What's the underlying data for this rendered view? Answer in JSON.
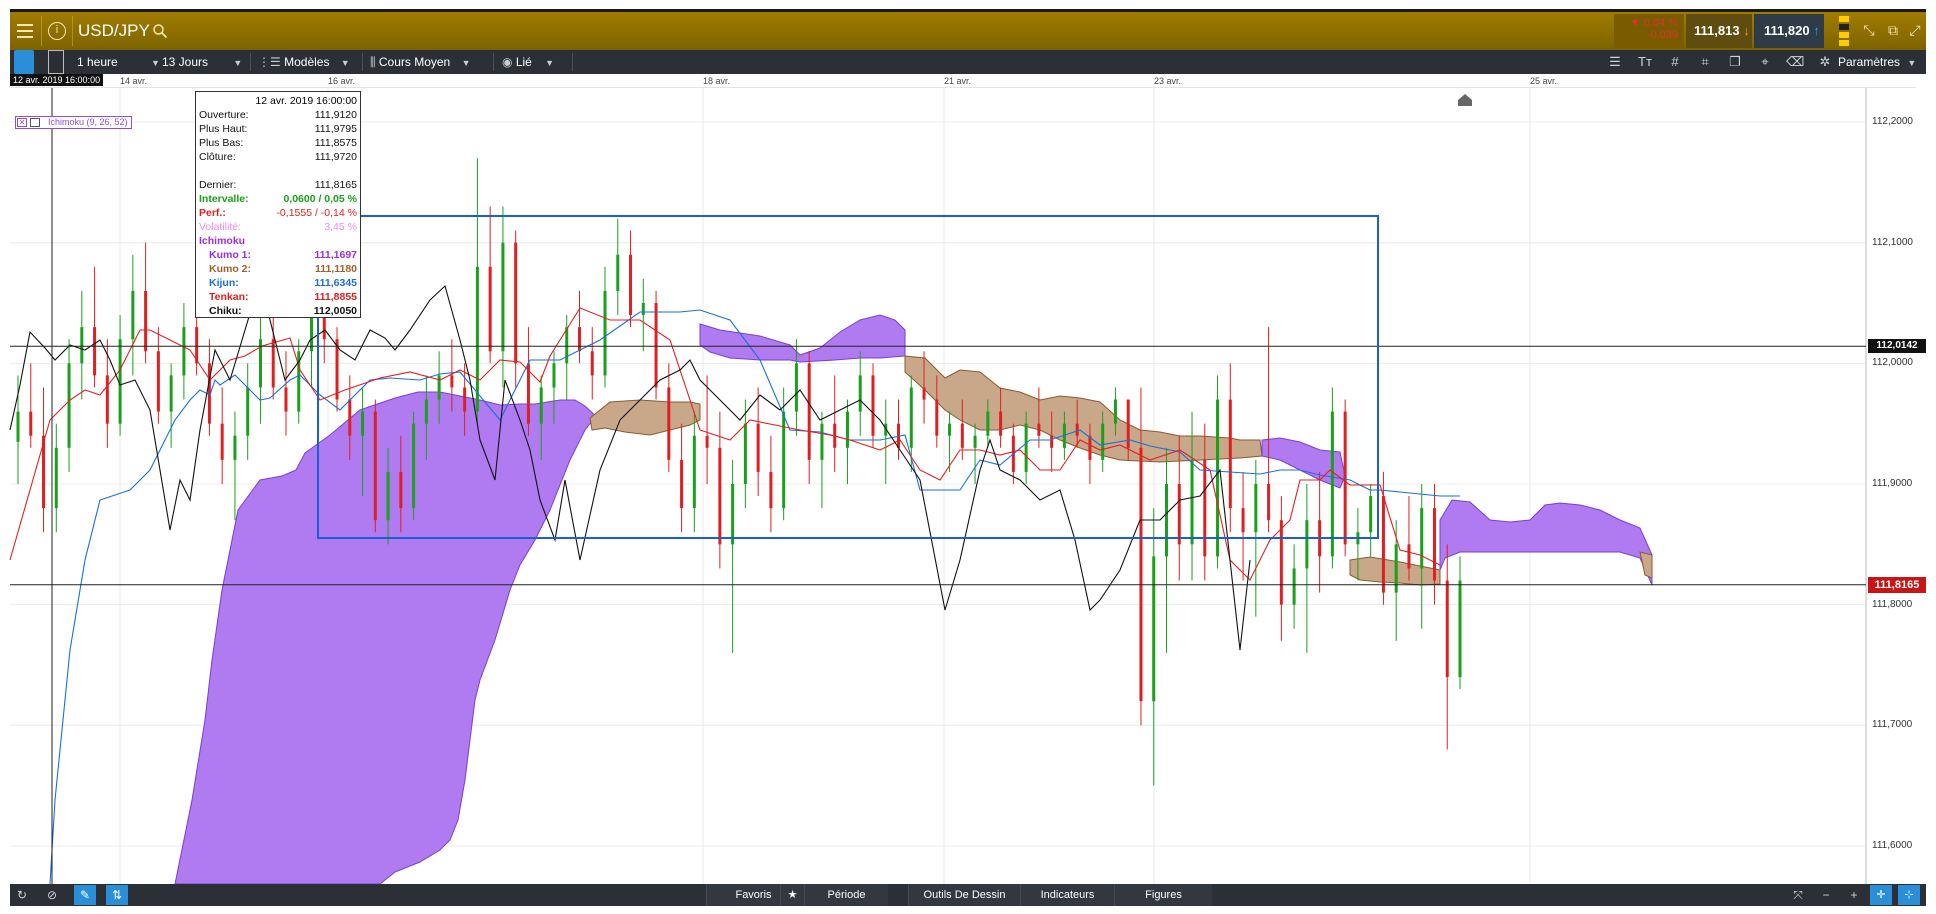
{
  "header": {
    "symbol": "USD/JPY",
    "change_pct": "▼ 0,04 %",
    "change_abs": "-0,039",
    "bid": "111,813",
    "ask": "111,820"
  },
  "toolbar": {
    "interval": "1 heure",
    "range": "13 Jours",
    "templates": "Modèles",
    "price_type": "Cours Moyen",
    "link": "Lié",
    "settings": "Paramètres"
  },
  "indicator_label": "Ichimoku (9, 26, 52)",
  "cursor_date": "12 avr. 2019 16:00:00",
  "tooltip": {
    "date": "12 avr. 2019 16:00:00",
    "rows": [
      {
        "label": "Ouverture:",
        "value": "111,9120"
      },
      {
        "label": "Plus Haut:",
        "value": "111,9795"
      },
      {
        "label": "Plus Bas:",
        "value": "111,8575"
      },
      {
        "label": "Clôture:",
        "value": "111,9720"
      },
      {
        "label": "",
        "value": ""
      },
      {
        "label": "Dernier:",
        "value": "111,8165"
      },
      {
        "label": "Intervalle:",
        "value": "0,0600 / 0,05 %"
      },
      {
        "label": "Perf.:",
        "value": "-0,1555 / -0,14 %"
      },
      {
        "label": "Volatilité:",
        "value": "3,45 %"
      },
      {
        "label": "Ichimoku",
        "value": ""
      },
      {
        "label": "Kumo 1:",
        "value": "111,1697"
      },
      {
        "label": "Kumo 2:",
        "value": "111,1180"
      },
      {
        "label": "Kijun:",
        "value": "111,6345"
      },
      {
        "label": "Tenkan:",
        "value": "111,8855"
      },
      {
        "label": "Chiku:",
        "value": "112,0050"
      }
    ]
  },
  "bottom": {
    "tabs": [
      "Favoris",
      "Période",
      "Outils De Dessin",
      "Indicateurs",
      "Figures"
    ]
  },
  "colors": {
    "kumo_purple": "#b07af0",
    "kumo_brown": "#c9a88a",
    "kijun": "#1a6fdc",
    "tenkan": "#e02020",
    "chiku": "#111111",
    "up": "#1aa01a",
    "down": "#e02020",
    "box": "#1a5fd8"
  },
  "chart_data": {
    "type": "candlestick",
    "ylim": [
      111.56,
      112.25
    ],
    "x_tick_labels": [
      "14 avr.",
      "16 avr.",
      "18 avr.",
      "21 avr.",
      "23 avr.",
      "25 avr."
    ],
    "y_tick_labels": [
      "112,2000",
      "112,1000",
      "112,0000",
      "111,9000",
      "111,8000",
      "111,7000",
      "111,6000"
    ],
    "y_tick_values": [
      112.2,
      112.1,
      112.0,
      111.9,
      111.8,
      111.7,
      111.6
    ],
    "last_price_line": 112.0142,
    "last_price_label": "112,0142",
    "current_price_line": 111.8165,
    "current_price_label": "111,8165",
    "box": {
      "x0": 66,
      "x1": 289,
      "y_top": 112.123,
      "y_bottom": 111.857
    },
    "slots": 330,
    "candles_seed": 7,
    "candles": [
      [
        111.935,
        111.99,
        111.9,
        111.96
      ],
      [
        111.96,
        112.0,
        111.93,
        111.94
      ],
      [
        111.94,
        111.98,
        111.86,
        111.88
      ],
      [
        111.88,
        111.95,
        111.86,
        111.93
      ],
      [
        111.93,
        112.02,
        111.91,
        112.0
      ],
      [
        112.0,
        112.06,
        111.97,
        112.03
      ],
      [
        112.03,
        112.08,
        111.98,
        111.99
      ],
      [
        111.99,
        112.02,
        111.93,
        111.95
      ],
      [
        111.95,
        112.04,
        111.94,
        112.02
      ],
      [
        112.02,
        112.09,
        111.99,
        112.06
      ],
      [
        112.06,
        112.1,
        112.0,
        112.01
      ],
      [
        112.01,
        112.03,
        111.95,
        111.96
      ],
      [
        111.96,
        112.0,
        111.93,
        111.99
      ],
      [
        111.99,
        112.05,
        111.97,
        112.03
      ],
      [
        112.03,
        112.07,
        111.99,
        112.0
      ],
      [
        112.0,
        112.02,
        111.94,
        111.95
      ],
      [
        111.95,
        111.98,
        111.9,
        111.92
      ],
      [
        111.92,
        111.96,
        111.87,
        111.94
      ],
      [
        111.94,
        112.0,
        111.92,
        111.98
      ],
      [
        111.98,
        112.04,
        111.95,
        112.02
      ],
      [
        112.02,
        112.05,
        111.97,
        111.98
      ],
      [
        111.98,
        112.01,
        111.94,
        111.96
      ],
      [
        111.96,
        112.02,
        111.95,
        112.01
      ],
      [
        112.01,
        112.06,
        111.98,
        112.04
      ],
      [
        112.04,
        112.07,
        112.0,
        112.02
      ],
      [
        112.02,
        112.03,
        111.96,
        111.97
      ],
      [
        111.97,
        111.99,
        111.92,
        111.94
      ],
      [
        111.94,
        111.98,
        111.89,
        111.96
      ],
      [
        111.96,
        111.97,
        111.86,
        111.87
      ],
      [
        111.87,
        111.93,
        111.85,
        111.91
      ],
      [
        111.91,
        111.94,
        111.86,
        111.88
      ],
      [
        111.88,
        111.96,
        111.87,
        111.95
      ],
      [
        111.95,
        111.99,
        111.92,
        111.97
      ],
      [
        111.97,
        112.01,
        111.95,
        111.99
      ],
      [
        111.99,
        112.02,
        111.96,
        111.98
      ],
      [
        111.98,
        112.0,
        111.94,
        111.96
      ],
      [
        111.96,
        112.17,
        111.95,
        112.08
      ],
      [
        112.08,
        112.13,
        112.0,
        112.01
      ],
      [
        112.01,
        112.13,
        111.98,
        112.1
      ],
      [
        112.1,
        112.11,
        111.98,
        112.0
      ],
      [
        112.0,
        112.03,
        111.94,
        111.95
      ],
      [
        111.95,
        111.99,
        111.92,
        111.98
      ],
      [
        111.98,
        112.01,
        111.95,
        112.0
      ],
      [
        112.0,
        112.04,
        111.97,
        112.03
      ],
      [
        112.03,
        112.06,
        112.0,
        112.01
      ],
      [
        112.01,
        112.03,
        111.97,
        111.99
      ],
      [
        111.99,
        112.08,
        111.98,
        112.06
      ],
      [
        112.06,
        112.12,
        112.04,
        112.09
      ],
      [
        112.09,
        112.11,
        112.03,
        112.04
      ],
      [
        112.04,
        112.07,
        112.01,
        112.05
      ],
      [
        112.05,
        112.06,
        111.97,
        111.98
      ],
      [
        111.98,
        112.0,
        111.91,
        111.92
      ],
      [
        111.92,
        111.95,
        111.86,
        111.88
      ],
      [
        111.88,
        111.96,
        111.86,
        111.94
      ],
      [
        111.94,
        111.99,
        111.9,
        111.93
      ],
      [
        111.93,
        111.96,
        111.83,
        111.85
      ],
      [
        111.85,
        111.92,
        111.76,
        111.9
      ],
      [
        111.9,
        111.97,
        111.88,
        111.95
      ],
      [
        111.95,
        111.98,
        111.89,
        111.91
      ],
      [
        111.91,
        111.94,
        111.86,
        111.88
      ],
      [
        111.88,
        111.98,
        111.87,
        111.96
      ],
      [
        111.96,
        112.02,
        111.94,
        112.0
      ],
      [
        112.0,
        112.01,
        111.9,
        111.92
      ],
      [
        111.92,
        111.96,
        111.88,
        111.95
      ],
      [
        111.95,
        111.99,
        111.91,
        111.93
      ],
      [
        111.93,
        111.97,
        111.9,
        111.96
      ],
      [
        111.96,
        112.01,
        111.94,
        111.99
      ],
      [
        111.99,
        112.0,
        111.93,
        111.94
      ],
      [
        111.94,
        111.97,
        111.9,
        111.95
      ],
      [
        111.95,
        111.97,
        111.92,
        111.93
      ],
      [
        111.93,
        111.99,
        111.91,
        111.98
      ],
      [
        111.98,
        112.01,
        111.95,
        111.97
      ],
      [
        111.97,
        111.99,
        111.93,
        111.94
      ],
      [
        111.94,
        111.96,
        111.91,
        111.95
      ],
      [
        111.95,
        111.97,
        111.92,
        111.93
      ],
      [
        111.93,
        111.95,
        111.9,
        111.94
      ],
      [
        111.94,
        111.97,
        111.93,
        111.96
      ],
      [
        111.96,
        111.98,
        111.93,
        111.94
      ],
      [
        111.94,
        111.95,
        111.9,
        111.91
      ],
      [
        111.91,
        111.96,
        111.9,
        111.95
      ],
      [
        111.95,
        111.98,
        111.93,
        111.94
      ],
      [
        111.94,
        111.96,
        111.91,
        111.93
      ],
      [
        111.93,
        111.96,
        111.92,
        111.95
      ],
      [
        111.95,
        111.97,
        111.93,
        111.94
      ],
      [
        111.94,
        111.95,
        111.9,
        111.92
      ],
      [
        111.92,
        111.96,
        111.91,
        111.95
      ],
      [
        111.95,
        111.98,
        111.94,
        111.97
      ],
      [
        111.97,
        111.97,
        111.92,
        111.93
      ],
      [
        111.93,
        111.98,
        111.7,
        111.72
      ],
      [
        111.72,
        111.88,
        111.65,
        111.84
      ],
      [
        111.84,
        111.93,
        111.76,
        111.9
      ],
      [
        111.9,
        111.94,
        111.82,
        111.85
      ],
      [
        111.85,
        111.96,
        111.82,
        111.92
      ],
      [
        111.92,
        111.95,
        111.82,
        111.84
      ],
      [
        111.84,
        111.99,
        111.83,
        111.97
      ],
      [
        111.97,
        112.0,
        111.86,
        111.88
      ],
      [
        111.88,
        111.91,
        111.82,
        111.86
      ],
      [
        111.86,
        111.92,
        111.79,
        111.9
      ],
      [
        111.9,
        112.03,
        111.86,
        111.87
      ],
      [
        111.87,
        111.89,
        111.77,
        111.8
      ],
      [
        111.8,
        111.85,
        111.78,
        111.83
      ],
      [
        111.83,
        111.9,
        111.76,
        111.87
      ],
      [
        111.87,
        111.91,
        111.81,
        111.84
      ],
      [
        111.84,
        111.98,
        111.83,
        111.96
      ],
      [
        111.96,
        111.97,
        111.84,
        111.85
      ],
      [
        111.85,
        111.88,
        111.82,
        111.86
      ],
      [
        111.86,
        111.9,
        111.84,
        111.89
      ],
      [
        111.89,
        111.91,
        111.8,
        111.81
      ],
      [
        111.81,
        111.87,
        111.77,
        111.85
      ],
      [
        111.85,
        111.89,
        111.82,
        111.83
      ],
      [
        111.83,
        111.9,
        111.78,
        111.88
      ],
      [
        111.88,
        111.9,
        111.8,
        111.82
      ],
      [
        111.82,
        111.85,
        111.68,
        111.74
      ],
      [
        111.74,
        111.84,
        111.73,
        111.82
      ]
    ]
  }
}
